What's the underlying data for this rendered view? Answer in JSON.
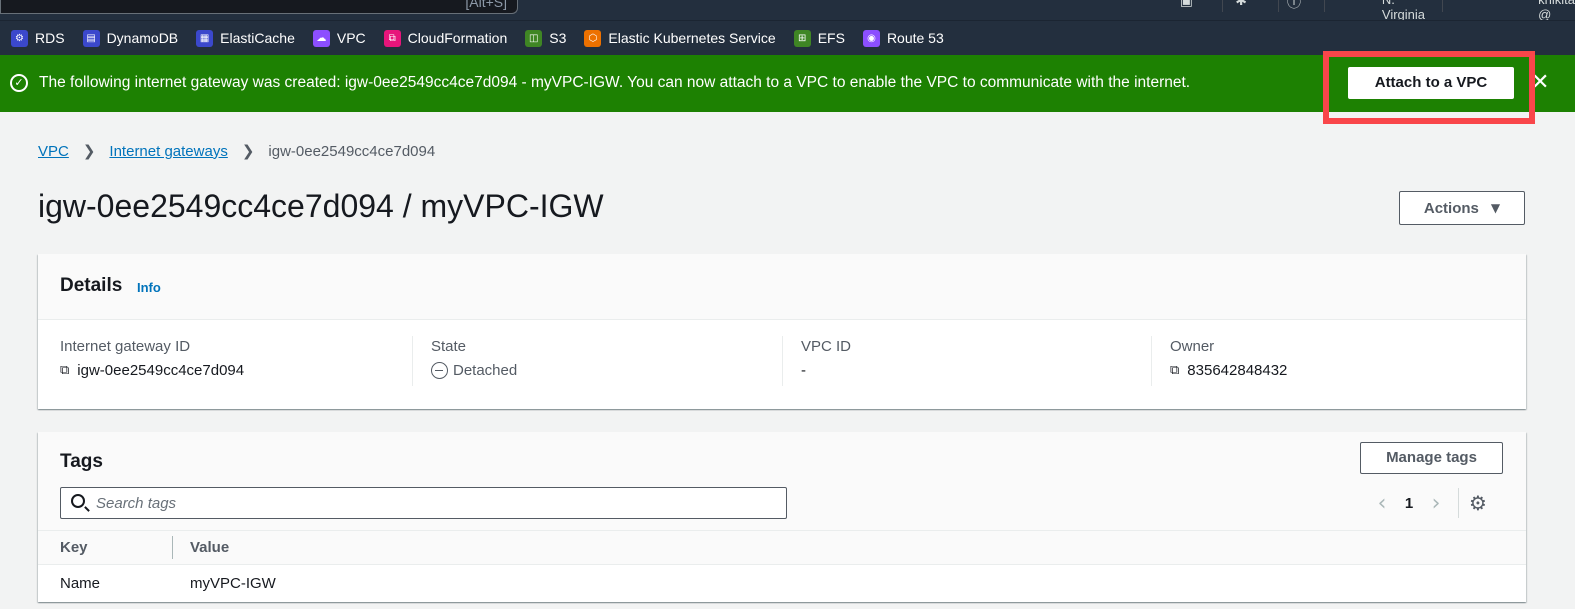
{
  "topnav": {
    "search_hint": "[Alt+S]",
    "region": "N. Virginia",
    "account": "knikita @ knikita"
  },
  "favorites": [
    {
      "label": "RDS",
      "icon": "rds-icon",
      "color": "#3b48cc"
    },
    {
      "label": "DynamoDB",
      "icon": "dynamodb-icon",
      "color": "#3b48cc"
    },
    {
      "label": "ElastiCache",
      "icon": "elasticache-icon",
      "color": "#3b48cc"
    },
    {
      "label": "VPC",
      "icon": "vpc-icon",
      "color": "#8c4fff"
    },
    {
      "label": "CloudFormation",
      "icon": "cloudformation-icon",
      "color": "#e7157b"
    },
    {
      "label": "S3",
      "icon": "s3-icon",
      "color": "#3f8624"
    },
    {
      "label": "Elastic Kubernetes Service",
      "icon": "eks-icon",
      "color": "#ed7100"
    },
    {
      "label": "EFS",
      "icon": "efs-icon",
      "color": "#3f8624"
    },
    {
      "label": "Route 53",
      "icon": "route53-icon",
      "color": "#8c4fff"
    }
  ],
  "flash": {
    "message": "The following internet gateway was created: igw-0ee2549cc4ce7d094 - myVPC-IGW. You can now attach to a VPC to enable the VPC to communicate with the internet.",
    "action_label": "Attach to a VPC",
    "color": "#1d8102"
  },
  "breadcrumb": {
    "root": "VPC",
    "section": "Internet gateways",
    "current": "igw-0ee2549cc4ce7d094"
  },
  "page": {
    "title": "igw-0ee2549cc4ce7d094 / myVPC-IGW",
    "actions_label": "Actions"
  },
  "details": {
    "heading": "Details",
    "info_link": "Info",
    "fields": [
      {
        "label": "Internet gateway ID",
        "value": "igw-0ee2549cc4ce7d094"
      },
      {
        "label": "State",
        "value": "Detached"
      },
      {
        "label": "VPC ID",
        "value": "-"
      },
      {
        "label": "Owner",
        "value": "835642848432"
      }
    ]
  },
  "tags": {
    "heading": "Tags",
    "manage_label": "Manage tags",
    "search_placeholder": "Search tags",
    "page_number": "1",
    "columns": [
      "Key",
      "Value"
    ],
    "rows": [
      {
        "key": "Name",
        "value": "myVPC-IGW"
      }
    ]
  }
}
